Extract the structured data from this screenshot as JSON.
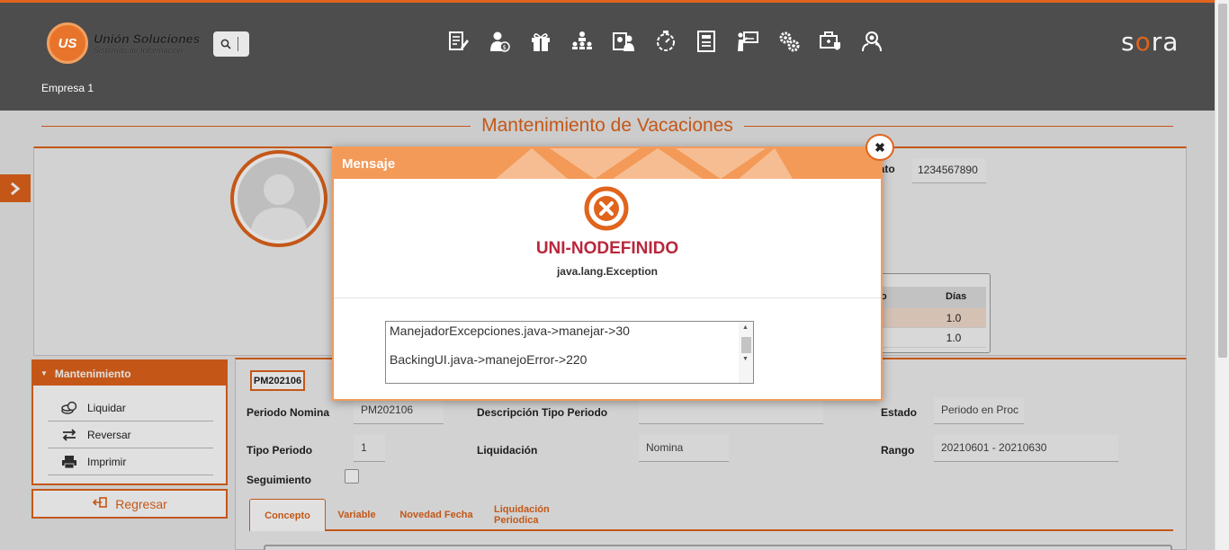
{
  "header": {
    "logo_title": "Unión Soluciones",
    "logo_subtitle": "Sistemas de Información",
    "logo_badge": "US",
    "brand": "sora",
    "company": "Empresa 1",
    "nav_icons": [
      "report-edit-icon",
      "user-money-icon",
      "gift-icon",
      "org-chart-icon",
      "employee-id-icon",
      "timer-icon",
      "document-list-icon",
      "training-board-icon",
      "settings-gears-icon",
      "medical-bag-icon",
      "user-search-icon"
    ]
  },
  "page": {
    "title": "Mantenimiento de Vacaciones"
  },
  "employee": {
    "contrato_label": "rato",
    "contrato_value": "1234567890",
    "table": {
      "col1": "o",
      "col2": "Días",
      "rows": [
        "1.0",
        "1.0"
      ]
    }
  },
  "menu": {
    "title": "Mantenimiento",
    "items": [
      {
        "label": "Liquidar",
        "icon": "coins-icon"
      },
      {
        "label": "Reversar",
        "icon": "swap-arrows-icon"
      },
      {
        "label": "Imprimir",
        "icon": "printer-icon"
      }
    ],
    "back_label": "Regresar"
  },
  "form": {
    "badge": "PM202106",
    "periodo_nomina_label": "Periodo Nomina",
    "periodo_nomina_value": "PM202106",
    "descripcion_label": "Descripción Tipo Periodo",
    "descripcion_value": "",
    "estado_label": "Estado",
    "estado_value": "Periodo en Proc",
    "tipo_periodo_label": "Tipo Periodo",
    "tipo_periodo_value": "1",
    "liquidacion_label": "Liquidación",
    "liquidacion_value": "Nomina",
    "rango_label": "Rango",
    "rango_value": "20210601 - 20210630",
    "seguimiento_label": "Seguimiento",
    "seguimiento_checked": false,
    "tabs": [
      "Concepto",
      "Variable",
      "Novedad Fecha",
      "Liquidación Periodica"
    ],
    "active_tab": "Concepto"
  },
  "dialog": {
    "title": "Mensaje",
    "error_code": "UNI-NODEFINIDO",
    "error_description": "java.lang.Exception",
    "trace": [
      "ManejadorExcepciones.java->manejar->30",
      "BackingUI.java->manejoError->220"
    ],
    "close_icon": "close-icon"
  },
  "colors": {
    "accent": "#e0641c",
    "header_bg": "#4d4d4d",
    "dialog_header": "#f39a58",
    "error_red": "#b8273c"
  }
}
